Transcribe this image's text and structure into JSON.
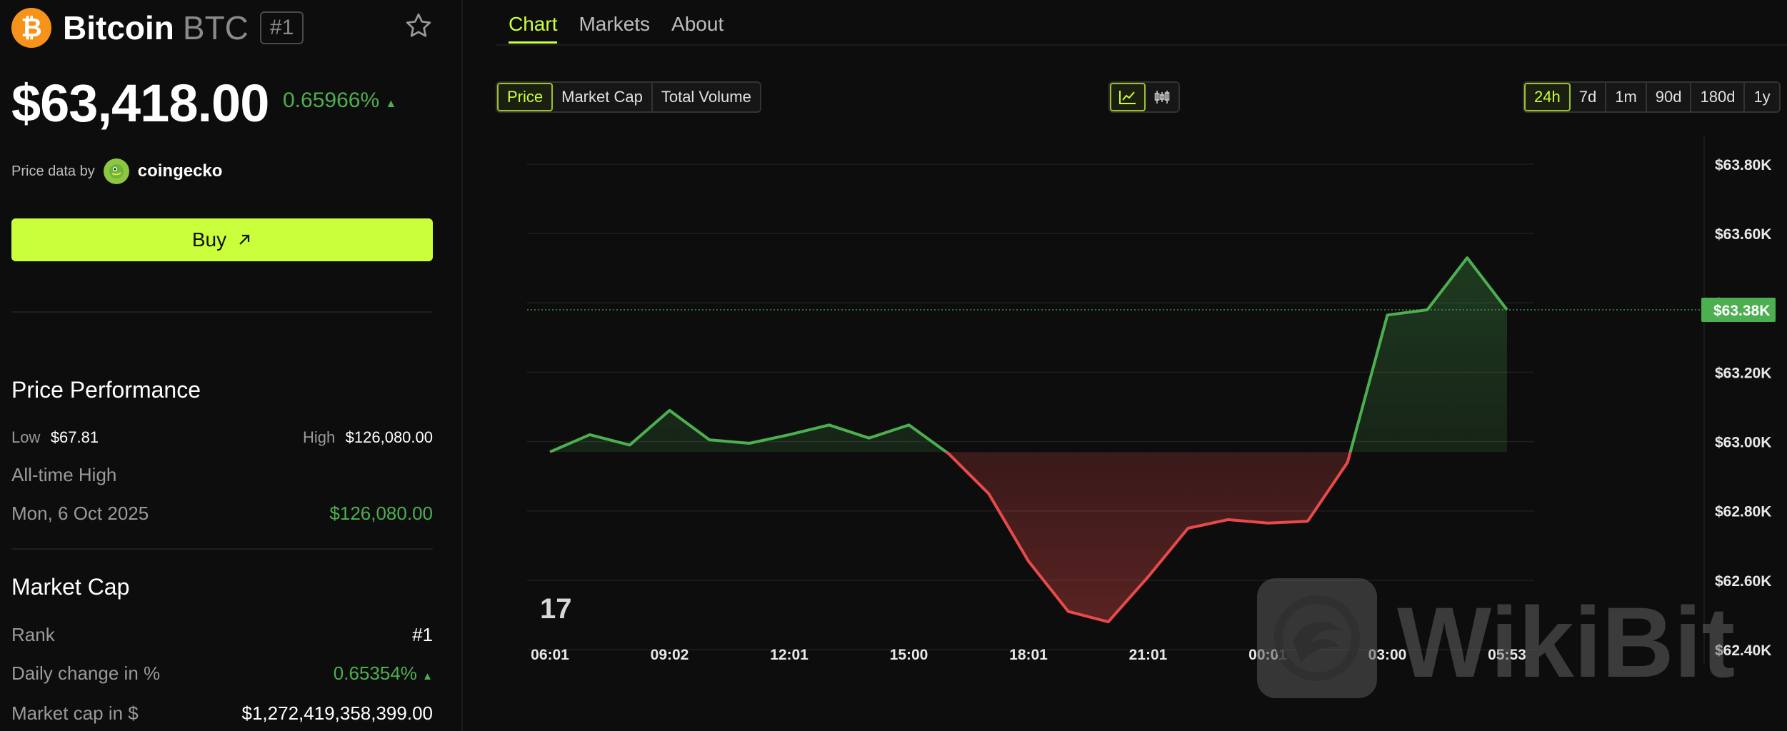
{
  "coin": {
    "name": "Bitcoin",
    "symbol": "BTC",
    "rank": "#1",
    "price": "$63,418.00",
    "change": "0.65966%",
    "change_arrow": "▲",
    "price_data_by": "Price data by",
    "provider": "coingecko",
    "buy_label": "Buy",
    "logo_icon": "bitcoin-icon"
  },
  "performance": {
    "title": "Price Performance",
    "low_label": "Low",
    "low_value": "$67.81",
    "high_label": "High",
    "high_value": "$126,080.00",
    "ath_label": "All-time High",
    "ath_date": "Mon, 6 Oct 2025",
    "ath_value": "$126,080.00"
  },
  "market_cap": {
    "title": "Market Cap",
    "rank_label": "Rank",
    "rank_value": "#1",
    "daily_label": "Daily change in %",
    "daily_value": "0.65354%",
    "daily_arrow": "▲",
    "cap_label": "Market cap in $",
    "cap_value": "$1,272,419,358,399.00"
  },
  "tabs": [
    "Chart",
    "Markets",
    "About"
  ],
  "metric_tabs": [
    "Price",
    "Market Cap",
    "Total Volume"
  ],
  "time_tabs": [
    "24h",
    "7d",
    "1m",
    "90d",
    "180d",
    "1y"
  ],
  "colors": {
    "accent": "#c9ff3b",
    "up": "#4caf50",
    "down": "#e84a4a",
    "bitcoin": "#f7931a"
  },
  "chart_data": {
    "type": "line",
    "x": [
      "06:01",
      "07:02",
      "08:02",
      "09:02",
      "10:02",
      "11:02",
      "12:01",
      "13:01",
      "14:01",
      "15:00",
      "16:00",
      "17:00",
      "18:01",
      "19:01",
      "20:01",
      "21:01",
      "22:01",
      "23:01",
      "00:01",
      "01:01",
      "02:01",
      "03:00",
      "04:00",
      "05:00",
      "05:53"
    ],
    "values": [
      62970,
      63020,
      62990,
      63090,
      63005,
      62995,
      63020,
      63048,
      63010,
      63048,
      62965,
      62850,
      62655,
      62510,
      62480,
      62610,
      62750,
      62775,
      62765,
      62770,
      62940,
      63365,
      63380,
      63530,
      63380
    ],
    "baseline": 62970,
    "current_label": "$63.38K",
    "current_value": 63380,
    "x_ticks": [
      "06:01",
      "09:02",
      "12:01",
      "15:00",
      "18:01",
      "21:01",
      "00:01",
      "03:00",
      "05:53"
    ],
    "y_ticks": [
      "$63.80K",
      "$63.60K",
      "$63.40K",
      "$63.20K",
      "$63.00K",
      "$62.80K",
      "$62.60K",
      "$62.40K"
    ],
    "ylim": [
      62400,
      63800
    ]
  },
  "watermark": "WikiBit",
  "tv_logo": "17"
}
